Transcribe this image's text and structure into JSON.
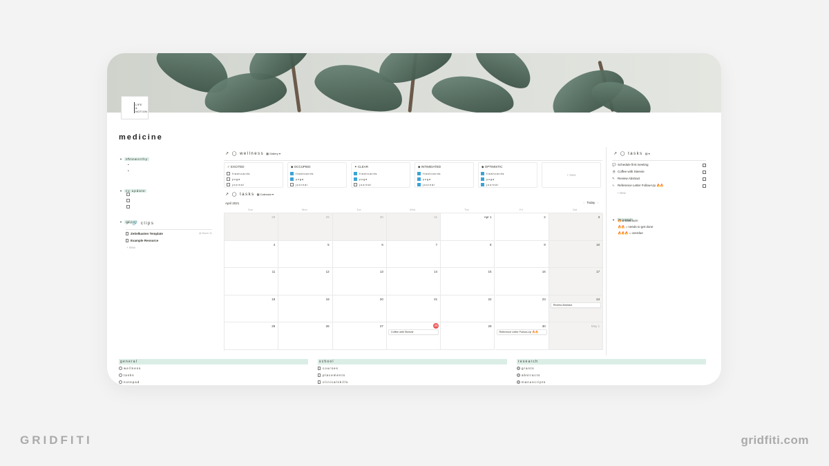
{
  "page": {
    "title": "medicine"
  },
  "logo": {
    "line1": "LIFE",
    "line2": "&",
    "line3": "NOTION"
  },
  "left": {
    "noteworthy": {
      "label": "noteworthy",
      "bullets": [
        "•",
        "•",
        "•"
      ]
    },
    "cv_update": {
      "label": "cv update"
    },
    "clips": {
      "label": "clips",
      "db_title": "clips",
      "items": [
        {
          "name": "Zettelkasten Template",
          "meta": "@ March 31"
        },
        {
          "name": "Example Resource",
          "meta": ""
        }
      ],
      "new": "+ New"
    }
  },
  "wellness": {
    "title": "wellness",
    "view": "Gallery",
    "cards": [
      {
        "title": "EXCITED",
        "icon": "✓",
        "rows": [
          {
            "label": "flashcards",
            "on": false
          },
          {
            "label": "yoga",
            "on": false
          },
          {
            "label": "journal",
            "on": false
          }
        ]
      },
      {
        "title": "OCCUPIED",
        "icon": "◆",
        "rows": [
          {
            "label": "flashcards",
            "on": true
          },
          {
            "label": "yoga",
            "on": true
          },
          {
            "label": "journal",
            "on": false
          }
        ]
      },
      {
        "title": "CLEAR",
        "icon": "✦",
        "rows": [
          {
            "label": "flashcards",
            "on": true
          },
          {
            "label": "yoga",
            "on": true
          },
          {
            "label": "journal",
            "on": false
          }
        ]
      },
      {
        "title": "INTIMIDATED",
        "icon": "◆",
        "rows": [
          {
            "label": "flashcards",
            "on": true
          },
          {
            "label": "yoga",
            "on": true
          },
          {
            "label": "journal",
            "on": true
          }
        ]
      },
      {
        "title": "OPTIMISTIC",
        "icon": "◆",
        "rows": [
          {
            "label": "flashcards",
            "on": true
          },
          {
            "label": "yoga",
            "on": true
          },
          {
            "label": "journal",
            "on": true
          }
        ]
      }
    ],
    "new": "+ New"
  },
  "calendar": {
    "title": "tasks",
    "view": "Calendar",
    "month": "April 2021",
    "today_label": "Today",
    "dows": [
      "Sun",
      "Mon",
      "Tue",
      "Wed",
      "Thu",
      "Fri",
      "Sat"
    ],
    "weeks": [
      [
        "28",
        "29",
        "30",
        "31",
        "Apr 1",
        "2",
        "3"
      ],
      [
        "4",
        "5",
        "6",
        "7",
        "8",
        "9",
        "10"
      ],
      [
        "11",
        "12",
        "13",
        "14",
        "15",
        "16",
        "17"
      ],
      [
        "18",
        "19",
        "20",
        "21",
        "22",
        "23",
        "24"
      ],
      [
        "25",
        "26",
        "27",
        "28",
        "29",
        "30",
        "May 1"
      ]
    ],
    "events": [
      {
        "week": 3,
        "day": 6,
        "label": "Review Abstract"
      },
      {
        "week": 4,
        "day": 3,
        "label": "Coffee with Steevie"
      },
      {
        "week": 4,
        "day": 5,
        "label": "Reference Letter Follow-Up 🔥🔥"
      }
    ]
  },
  "tasks": {
    "title": "tasks",
    "items": [
      {
        "icon": "💬",
        "label": "Schedule first meeting"
      },
      {
        "icon": "☕",
        "label": "Coffee with Steevie"
      },
      {
        "icon": "✎",
        "label": "Review Abstract"
      },
      {
        "icon": "∿",
        "label": "Reference Letter Follow-Up"
      }
    ],
    "new": "+ New"
  },
  "legend": {
    "title": "legend",
    "items": [
      {
        "flames": "🔥",
        "label": "= slow burn"
      },
      {
        "flames": "🔥🔥",
        "label": "= needs to get done"
      },
      {
        "flames": "🔥🔥🔥",
        "label": "= overdue"
      }
    ]
  },
  "bottom": {
    "general": {
      "label": "general",
      "items": [
        "wellness",
        "tasks",
        "notepad"
      ]
    },
    "school": {
      "label": "school",
      "items": [
        "courses",
        "placements",
        "clinicalskills"
      ]
    },
    "research": {
      "label": "research",
      "items": [
        "grants",
        "abstracts",
        "manuscripts"
      ]
    }
  },
  "brand": {
    "left": "GRIDFITI",
    "right": "gridfiti.com"
  }
}
